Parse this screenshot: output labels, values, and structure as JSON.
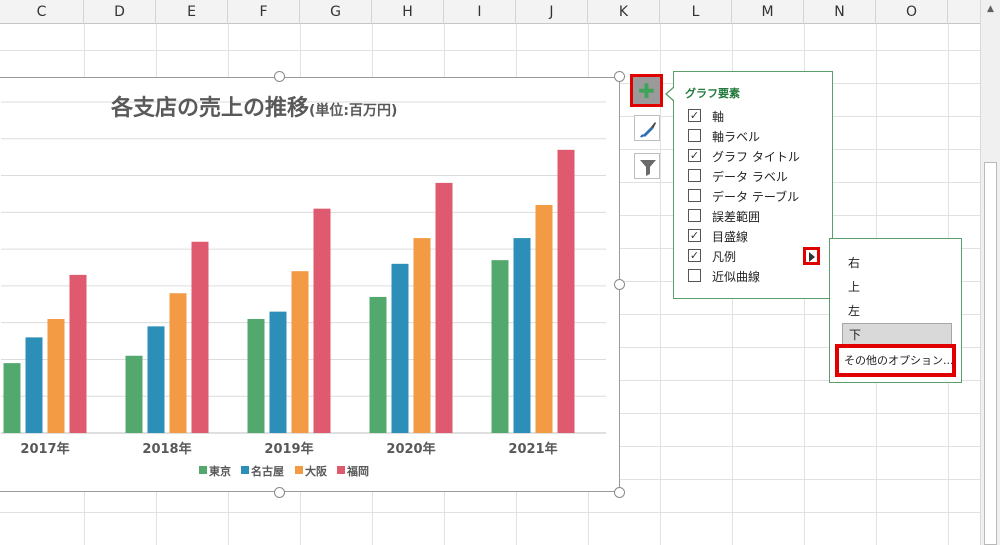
{
  "sheet": {
    "columns": [
      "C",
      "D",
      "E",
      "F",
      "G",
      "H",
      "I",
      "J",
      "K",
      "L",
      "M",
      "N",
      "O"
    ]
  },
  "chart": {
    "title": "各支店の売上の推移",
    "title_unit": "(単位:百万円)"
  },
  "chart_data": {
    "type": "bar",
    "title": "各支店の売上の推移(単位:百万円)",
    "categories": [
      "2017年",
      "2018年",
      "2019年",
      "2020年",
      "2021年"
    ],
    "series": [
      {
        "name": "東京",
        "color": "#53a86e",
        "values": [
          19,
          21,
          31,
          37,
          47
        ]
      },
      {
        "name": "名古屋",
        "color": "#2d8fb8",
        "values": [
          26,
          29,
          33,
          46,
          53
        ]
      },
      {
        "name": "大阪",
        "color": "#f39a45",
        "values": [
          31,
          38,
          44,
          53,
          62
        ]
      },
      {
        "name": "福岡",
        "color": "#df5a6f",
        "values": [
          43,
          52,
          61,
          68,
          77
        ]
      }
    ],
    "ylim": [
      0,
      90
    ],
    "gridlines": true,
    "gridline_step": 10,
    "legend_position": "bottom"
  },
  "side_buttons": {
    "elements_icon": "plus-icon",
    "styles_icon": "brush-icon",
    "filter_icon": "funnel-icon"
  },
  "elements_panel": {
    "title": "グラフ要素",
    "items": [
      {
        "label": "軸",
        "checked": true
      },
      {
        "label": "軸ラベル",
        "checked": false
      },
      {
        "label": "グラフ タイトル",
        "checked": true
      },
      {
        "label": "データ ラベル",
        "checked": false
      },
      {
        "label": "データ テーブル",
        "checked": false
      },
      {
        "label": "誤差範囲",
        "checked": false
      },
      {
        "label": "目盛線",
        "checked": true
      },
      {
        "label": "凡例",
        "checked": true
      },
      {
        "label": "近似曲線",
        "checked": false
      }
    ]
  },
  "legend_submenu": {
    "right": "右",
    "top": "上",
    "left": "左",
    "bottom": "下",
    "more": "その他のオプション..."
  },
  "colors": {
    "highlight": "#e00000",
    "panel_border": "#5b9e6c",
    "panel_title": "#227a3c"
  }
}
